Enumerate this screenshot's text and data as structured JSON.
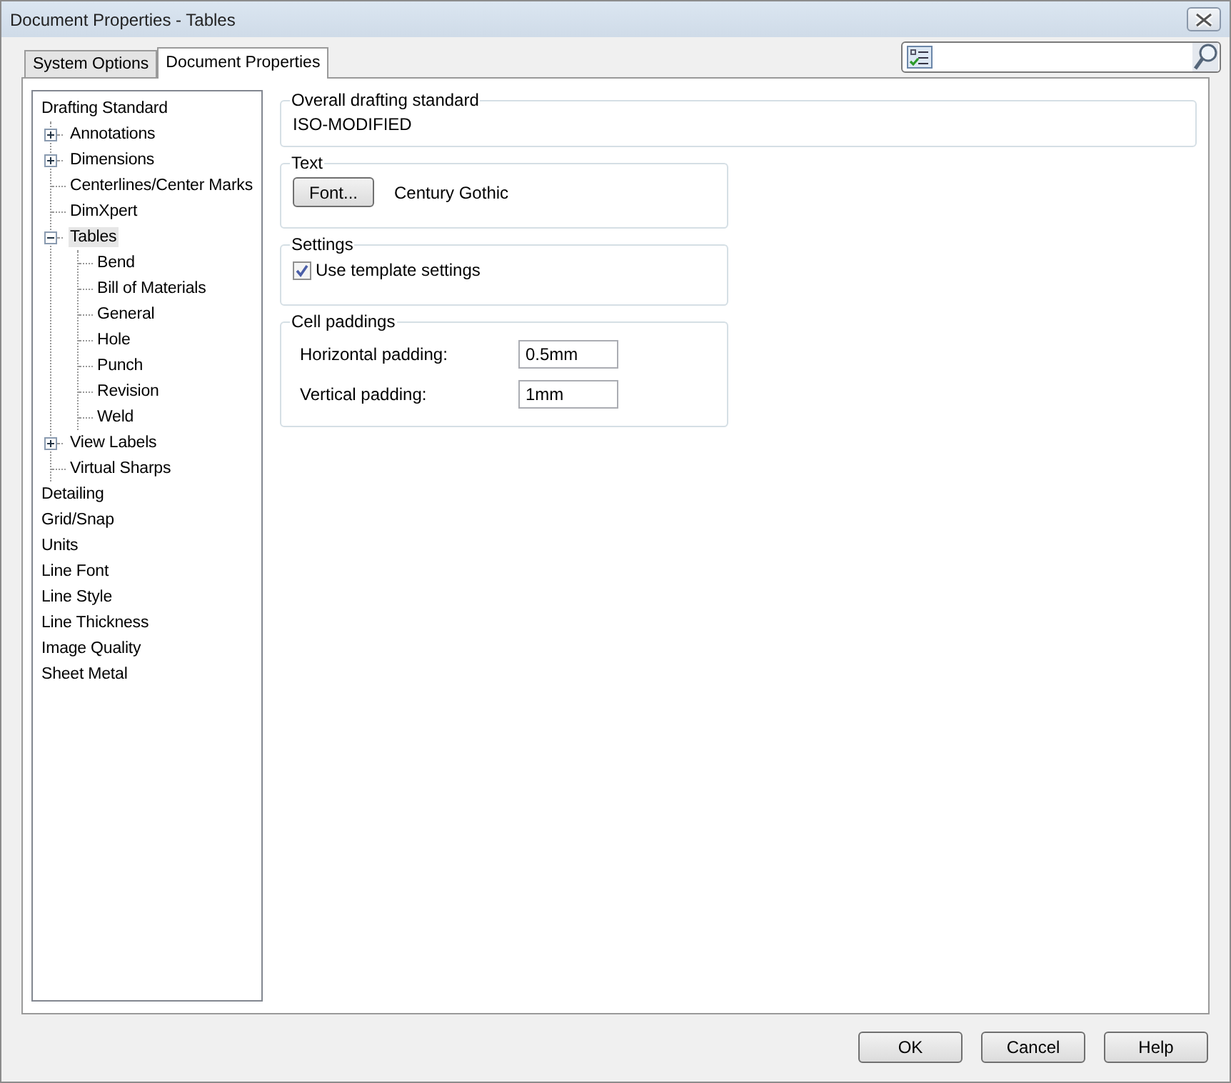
{
  "window": {
    "title": "Document Properties - Tables"
  },
  "tabs": [
    {
      "label": "System Options",
      "selected": false
    },
    {
      "label": "Document Properties",
      "selected": true
    }
  ],
  "tree": [
    {
      "label": "Drafting Standard",
      "selected": false,
      "children": [
        {
          "label": "Annotations",
          "expanded": false,
          "selected": false
        },
        {
          "label": "Dimensions",
          "expanded": false,
          "selected": false
        },
        {
          "label": "Centerlines/Center Marks",
          "selected": false
        },
        {
          "label": "DimXpert",
          "selected": false
        },
        {
          "label": "Tables",
          "expanded": true,
          "selected": true,
          "children": [
            {
              "label": "Bend",
              "selected": false
            },
            {
              "label": "Bill of Materials",
              "selected": false
            },
            {
              "label": "General",
              "selected": false
            },
            {
              "label": "Hole",
              "selected": false
            },
            {
              "label": "Punch",
              "selected": false
            },
            {
              "label": "Revision",
              "selected": false
            },
            {
              "label": "Weld",
              "selected": false
            }
          ]
        },
        {
          "label": "View Labels",
          "expanded": false,
          "selected": false
        },
        {
          "label": "Virtual Sharps",
          "selected": false
        }
      ]
    },
    {
      "label": "Detailing",
      "selected": false
    },
    {
      "label": "Grid/Snap",
      "selected": false
    },
    {
      "label": "Units",
      "selected": false
    },
    {
      "label": "Line Font",
      "selected": false
    },
    {
      "label": "Line Style",
      "selected": false
    },
    {
      "label": "Line Thickness",
      "selected": false
    },
    {
      "label": "Image Quality",
      "selected": false
    },
    {
      "label": "Sheet Metal",
      "selected": false
    }
  ],
  "overall_drafting_standard": {
    "title": "Overall drafting standard",
    "value": "ISO-MODIFIED"
  },
  "text": {
    "title": "Text",
    "button": "Font...",
    "font": "Century Gothic"
  },
  "settings": {
    "title": "Settings",
    "checkbox": {
      "label": "Use template settings",
      "checked": true
    }
  },
  "cell_paddings": {
    "title": "Cell paddings",
    "fields": [
      {
        "label": "Horizontal padding:",
        "value": "0.5mm"
      },
      {
        "label": "Vertical padding:",
        "value": "1mm"
      }
    ]
  },
  "buttons": [
    "OK",
    "Cancel",
    "Help"
  ]
}
